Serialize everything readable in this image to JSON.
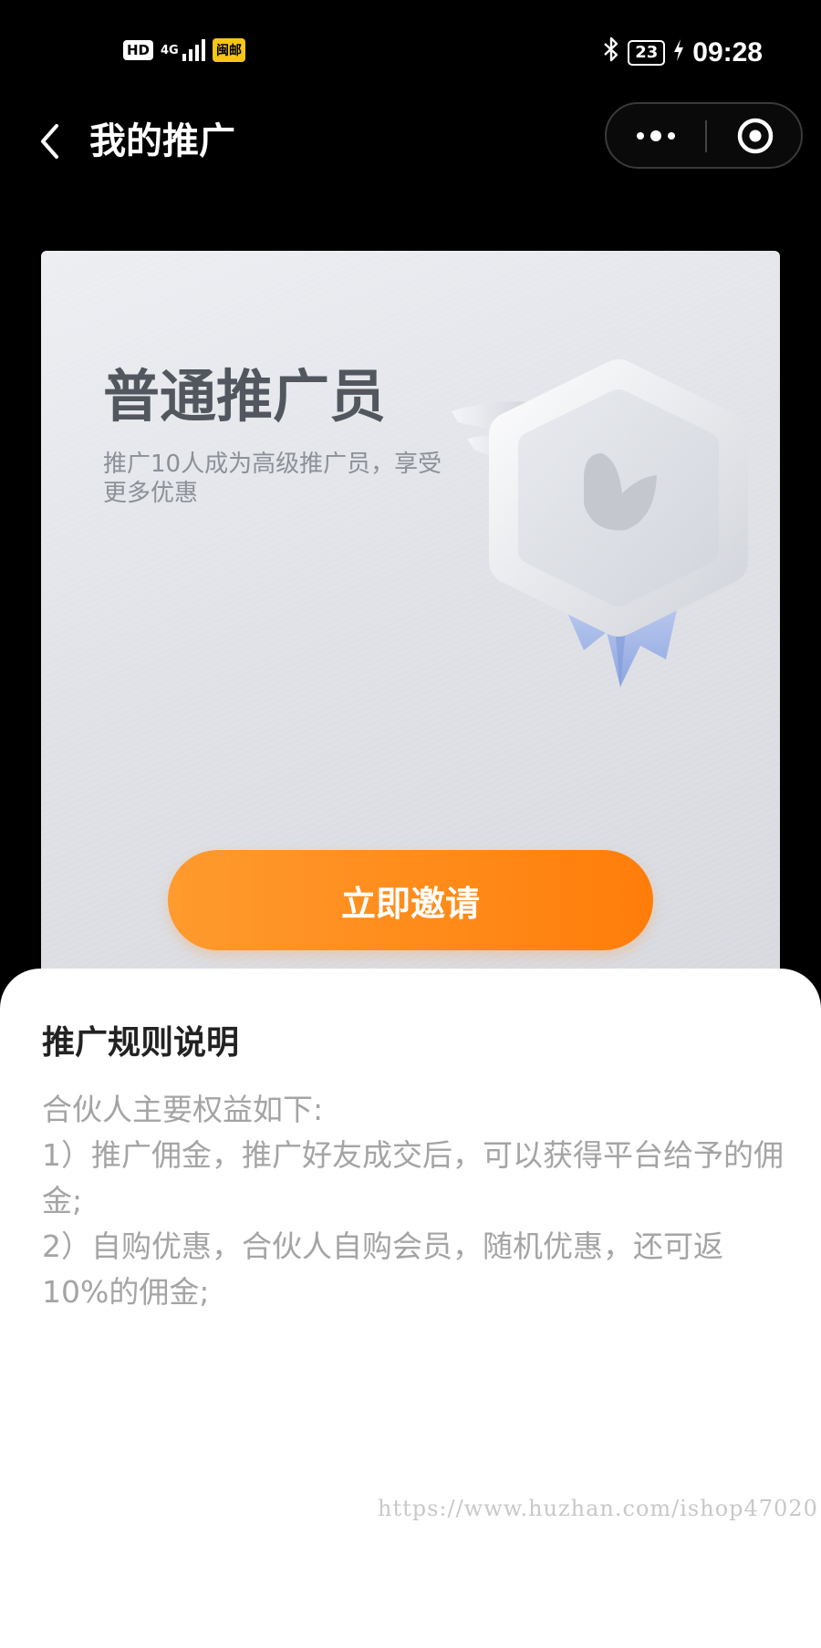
{
  "status_bar": {
    "hd": "HD",
    "network": "4G",
    "carrier": "闽邮",
    "battery": "23",
    "time": "09:28"
  },
  "nav": {
    "title": "我的推广"
  },
  "card": {
    "level_title": "普通推广员",
    "level_desc": "推广10人成为高级推广员，享受更多优惠",
    "invite_button": "立即邀请"
  },
  "rules": {
    "title": "推广规则说明",
    "lines": [
      "合伙人主要权益如下:",
      "1）推广佣金，推广好友成交后，可以获得平台给予的佣金;",
      "2）自购优惠，合伙人自购会员，随机优惠，还可返10%的佣金;"
    ]
  },
  "watermark": "https://www.huzhan.com/ishop47020",
  "colors": {
    "accent_orange": "#ff8a18",
    "title_gray": "#52565e",
    "rules_text": "#a4a4a4"
  },
  "icons": {
    "back": "chevron-left-icon",
    "more": "more-dots-icon",
    "close": "target-close-icon",
    "bluetooth": "bluetooth-icon",
    "charging": "bolt-icon",
    "medal": "leaf-medal-icon"
  }
}
